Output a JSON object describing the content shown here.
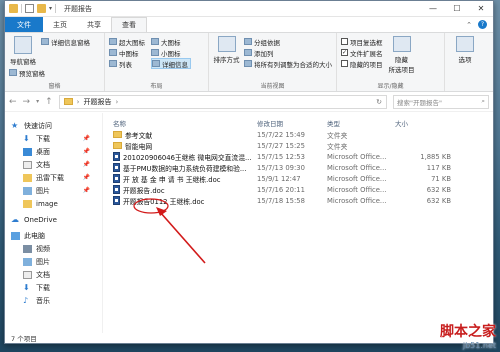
{
  "window": {
    "title": "开题报告"
  },
  "tabs": [
    {
      "label": "文件"
    },
    {
      "label": "主页"
    },
    {
      "label": "共享"
    },
    {
      "label": "查看"
    }
  ],
  "ribbon": {
    "panes": {
      "nav_pane": "导航窗格",
      "preview_pane": "预览窗格",
      "details_pane": "详细信息窗格",
      "label": "窗格"
    },
    "layout": {
      "items": [
        "超大图标",
        "大图标",
        "中图标",
        "小图标",
        "列表",
        "详细信息"
      ],
      "label": "布局"
    },
    "current_view": {
      "sort_by": "排序方式",
      "group_by": "分组依据",
      "add_columns": "添加列",
      "size_all_columns": "将所有列调整为合适的大小",
      "label": "当前视图"
    },
    "show_hide": {
      "item_checkboxes": "项目复选框",
      "file_extensions": "文件扩展名",
      "hidden_items": "隐藏的项目",
      "hide_selected": "隐藏",
      "selected_items": "所选项目",
      "label": "显示/隐藏"
    },
    "options": "选项"
  },
  "address": {
    "path": "开题报告",
    "search_placeholder": "搜索\"开题报告\""
  },
  "nav": {
    "quick_access": "快速访问",
    "downloads": "下载",
    "desktop": "桌面",
    "documents": "文档",
    "thunder": "迅雷下载",
    "pictures": "图片",
    "image": "image",
    "onedrive": "OneDrive",
    "this_pc": "此电脑",
    "videos": "视频",
    "pictures2": "图片",
    "documents2": "文档",
    "downloads2": "下载",
    "music": "音乐"
  },
  "columns": {
    "name": "名称",
    "date": "修改日期",
    "type": "类型",
    "size": "大小"
  },
  "files": [
    {
      "name": "参考文献",
      "date": "15/7/22 15:49",
      "type": "文件夹",
      "size": "",
      "kind": "folder"
    },
    {
      "name": "智能电网",
      "date": "15/7/27 15:25",
      "type": "文件夹",
      "size": "",
      "kind": "folder"
    },
    {
      "name": "201020906046王继栋 微电网交直流混...",
      "date": "15/7/15 12:53",
      "type": "Microsoft Office...",
      "size": "1,885 KB",
      "kind": "doc"
    },
    {
      "name": "基于PMU数据的电力系统负荷建模和验...",
      "date": "15/7/13 09:30",
      "type": "Microsoft Office...",
      "size": "117 KB",
      "kind": "doc"
    },
    {
      "name": "开 放 基 金 申 请 书  王继栋.doc",
      "date": "15/9/1 12:47",
      "type": "Microsoft Office...",
      "size": "71 KB",
      "kind": "doc"
    },
    {
      "name": "开题报告.doc",
      "date": "15/7/16 20:11",
      "type": "Microsoft Office...",
      "size": "632 KB",
      "kind": "doc"
    },
    {
      "name": "开题报告0112 王继栋.doc",
      "date": "15/7/18 15:58",
      "type": "Microsoft Office...",
      "size": "632 KB",
      "kind": "doc"
    }
  ],
  "status": {
    "count": "7 个项目"
  },
  "watermark": {
    "big": "脚本之家",
    "small": "jb51.net"
  },
  "colors": {
    "accent": "#1979ca",
    "annotation": "#d21a1a"
  }
}
